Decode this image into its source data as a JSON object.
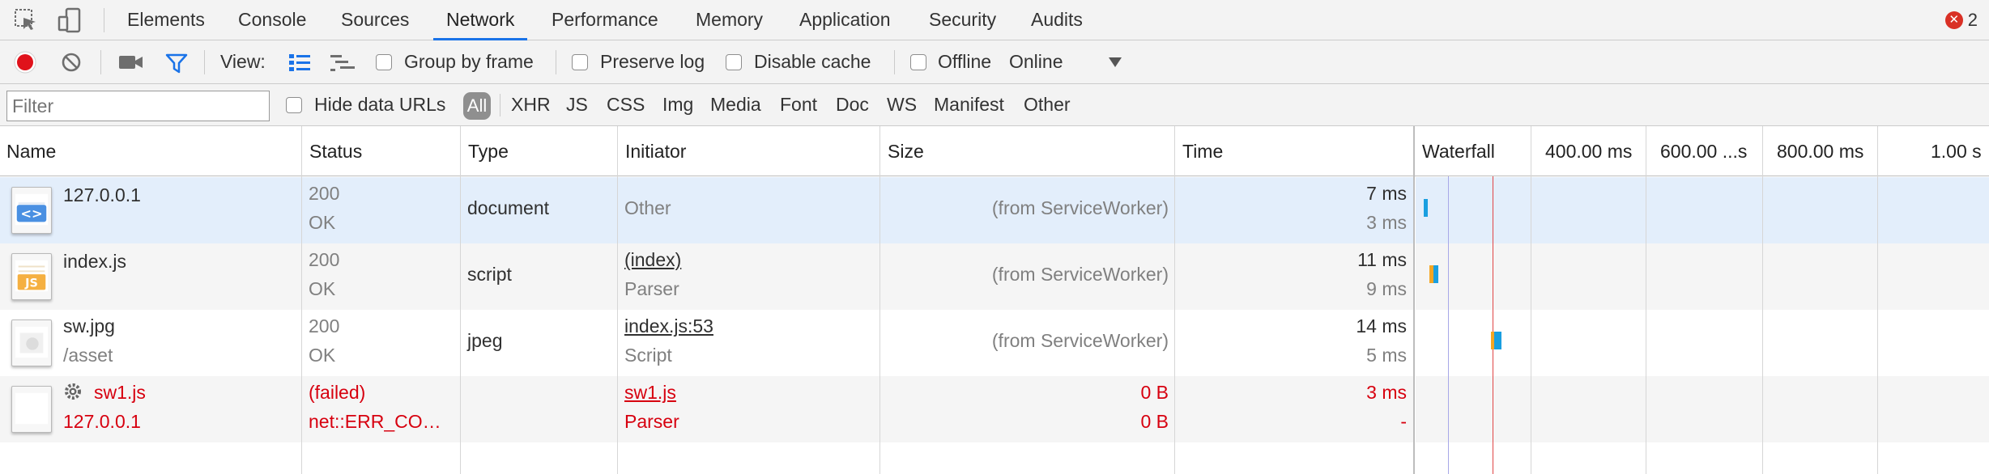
{
  "tabs": [
    "Elements",
    "Console",
    "Sources",
    "Network",
    "Performance",
    "Memory",
    "Application",
    "Security",
    "Audits"
  ],
  "active_tab": "Network",
  "error_count": "2",
  "toolbar": {
    "view_label": "View:",
    "group_by_frame": "Group by frame",
    "preserve_log": "Preserve log",
    "disable_cache": "Disable cache",
    "offline": "Offline",
    "throttling": "Online"
  },
  "filterbar": {
    "filter_placeholder": "Filter",
    "hide_data_urls": "Hide data URLs",
    "types": [
      "All",
      "XHR",
      "JS",
      "CSS",
      "Img",
      "Media",
      "Font",
      "Doc",
      "WS",
      "Manifest",
      "Other"
    ]
  },
  "columns": {
    "name": "Name",
    "status": "Status",
    "type": "Type",
    "initiator": "Initiator",
    "size": "Size",
    "time": "Time",
    "waterfall": "Waterfall",
    "ticks": [
      "400.00 ms",
      "600.00 ...s",
      "800.00 ms",
      "1.00 s"
    ]
  },
  "rows": [
    {
      "name": "127.0.0.1",
      "path": "",
      "status": "200",
      "status_text": "OK",
      "type": "document",
      "initiator": "Other",
      "initiator_detail": "",
      "size": "(from ServiceWorker)",
      "size2": "",
      "time": "7 ms",
      "latency": "3 ms",
      "icon": "html-doc-icon"
    },
    {
      "name": "index.js",
      "path": "",
      "status": "200",
      "status_text": "OK",
      "type": "script",
      "initiator": "(index)",
      "initiator_detail": "Parser",
      "size": "(from ServiceWorker)",
      "size2": "",
      "time": "11 ms",
      "latency": "9 ms",
      "icon": "js-file-icon"
    },
    {
      "name": "sw.jpg",
      "path": "/asset",
      "status": "200",
      "status_text": "OK",
      "type": "jpeg",
      "initiator": "index.js:53",
      "initiator_detail": "Script",
      "size": "(from ServiceWorker)",
      "size2": "",
      "time": "14 ms",
      "latency": "5 ms",
      "icon": "image-file-icon"
    },
    {
      "name": "sw1.js",
      "path": "127.0.0.1",
      "status": "(failed)",
      "status_text": "net::ERR_CO…",
      "type": "",
      "initiator": "sw1.js",
      "initiator_detail": "Parser",
      "size": "0 B",
      "size2": "0 B",
      "time": "3 ms",
      "latency": "-",
      "icon": "blank-file-icon"
    }
  ],
  "colors": {
    "accent": "#1a73e8",
    "error": "#d7000f",
    "selected_row": "#e3eefb",
    "alt_row": "#f5f5f5"
  }
}
